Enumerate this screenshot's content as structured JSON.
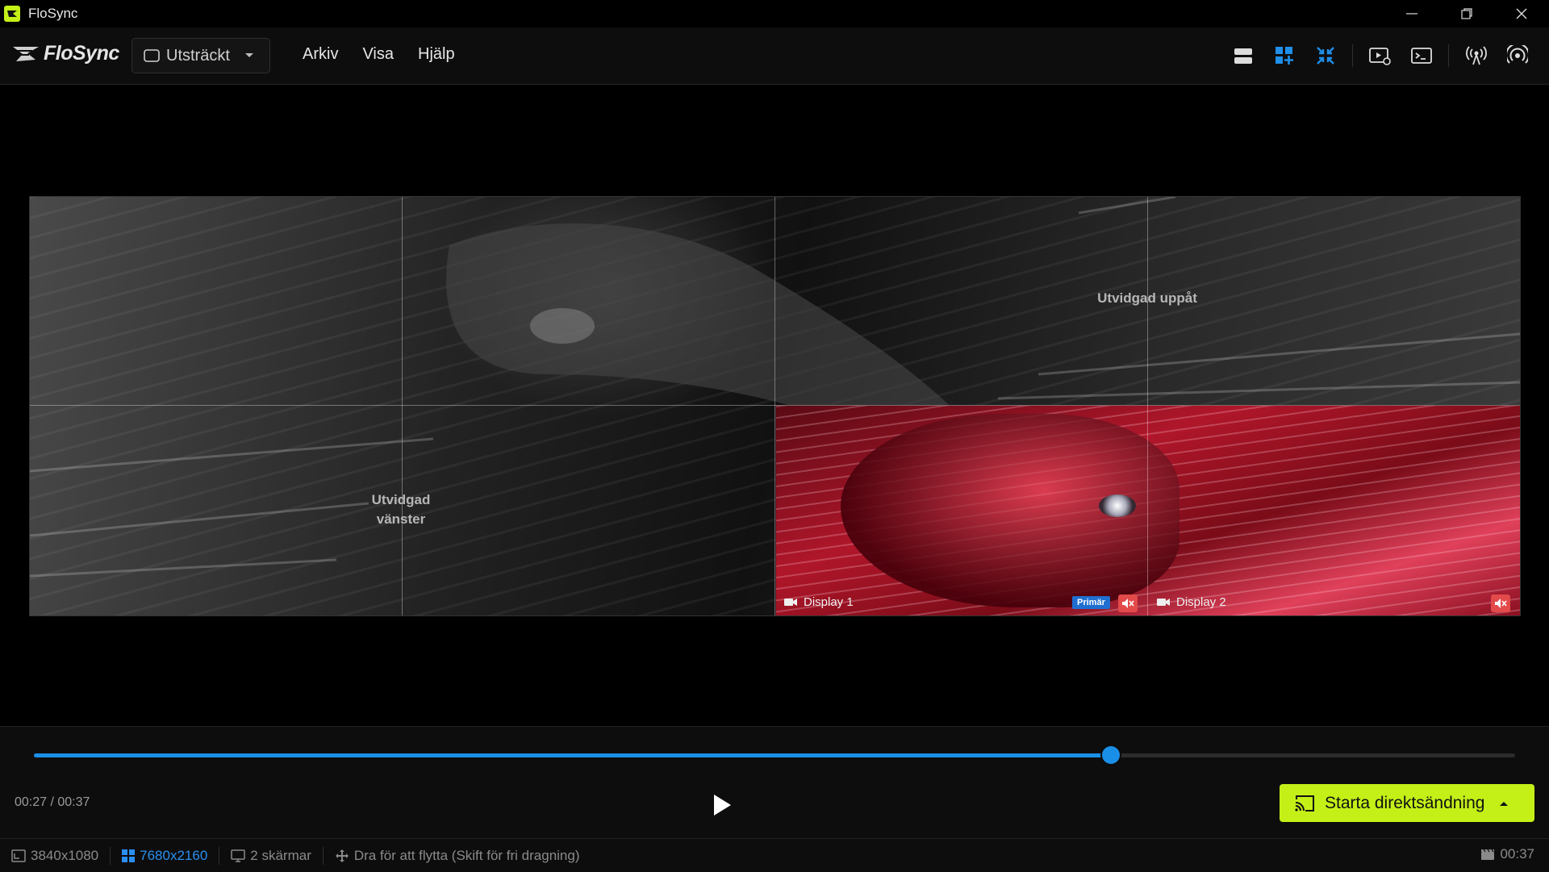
{
  "window": {
    "title": "FloSync"
  },
  "menubar": {
    "brand": "FloSync",
    "mode_select": {
      "value": "Utsträckt"
    },
    "menu": [
      "Arkiv",
      "Visa",
      "Hjälp"
    ],
    "toolbar_icons": [
      "list-layout-icon",
      "grid-add-icon",
      "collapse-icon",
      "play-settings-icon",
      "terminal-icon",
      "broadcast-icon",
      "signal-icon"
    ],
    "accent": "#1f8fea"
  },
  "canvas": {
    "regions": {
      "left": "Utvidgad vänster",
      "left_line1": "Utvidgad",
      "left_line2": "vänster",
      "up": "Utvidgad uppåt"
    },
    "displays": [
      {
        "label": "Display 1",
        "badge": "Primär",
        "muted": true
      },
      {
        "label": "Display 2",
        "muted": true
      }
    ]
  },
  "playback": {
    "current": "00:27",
    "total": "00:37",
    "time_text": "00:27 / 00:37",
    "progress": 0.727,
    "live_button": "Starta direktsändning",
    "live_color": "#c4f018"
  },
  "statusbar": {
    "resolution_display": "3840x1080",
    "resolution_canvas": "7680x2160",
    "screens": "2 skärmar",
    "hint": "Dra för att flytta (Skift för fri dragning)",
    "duration": "00:37"
  }
}
